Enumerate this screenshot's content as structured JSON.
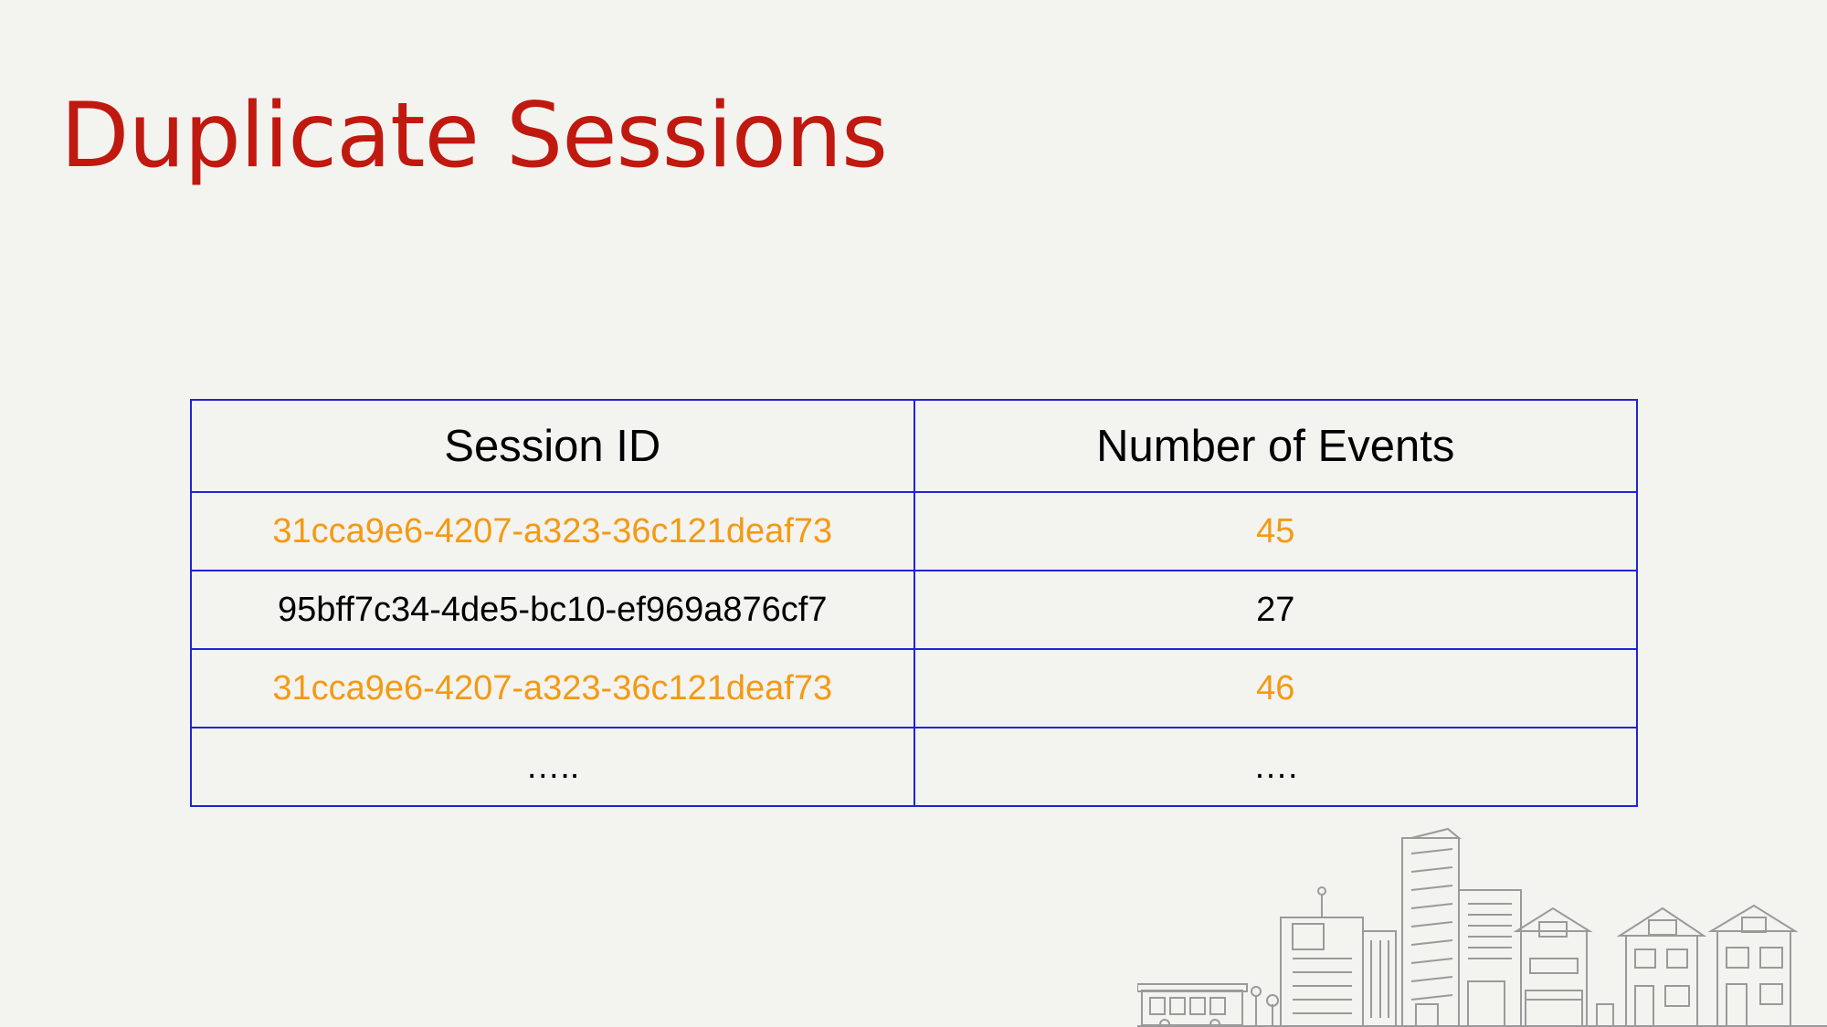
{
  "slide": {
    "title": "Duplicate Sessions"
  },
  "table": {
    "columns": [
      "Session ID",
      "Number of Events"
    ],
    "rows": [
      {
        "session_id": "31cca9e6-4207-a323-36c121deaf73",
        "events": "45",
        "highlight": true
      },
      {
        "session_id": "95bff7c34-4de5-bc10-ef969a876cf7",
        "events": "27",
        "highlight": false
      },
      {
        "session_id": "31cca9e6-4207-a323-36c121deaf73",
        "events": "46",
        "highlight": true
      },
      {
        "session_id": "…..",
        "events": "….",
        "highlight": false
      }
    ]
  },
  "colors": {
    "title": "#c0190f",
    "table_border": "#1f24d8",
    "highlight_text": "#f39a13",
    "background": "#f3f3f0"
  },
  "decoration": {
    "icon": "city-skyline-illustration"
  }
}
